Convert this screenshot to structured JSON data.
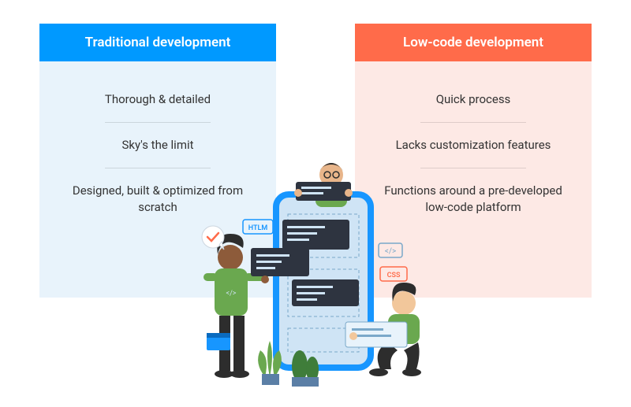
{
  "left": {
    "title": "Traditional development",
    "items": [
      "Thorough & detailed",
      "Sky's the limit",
      "Designed, built & optimized from scratch"
    ],
    "header_color": "#0099ff",
    "body_color": "#e8f3fb"
  },
  "right": {
    "title": "Low-code development",
    "items": [
      "Quick process",
      "Lacks customization features",
      "Functions around a pre-developed low-code platform"
    ],
    "header_color": "#ff6b4a",
    "body_color": "#fde9e5"
  },
  "illustration": {
    "tag_html": "HTLM",
    "tag_css": "CSS",
    "tag_code": "</>"
  }
}
